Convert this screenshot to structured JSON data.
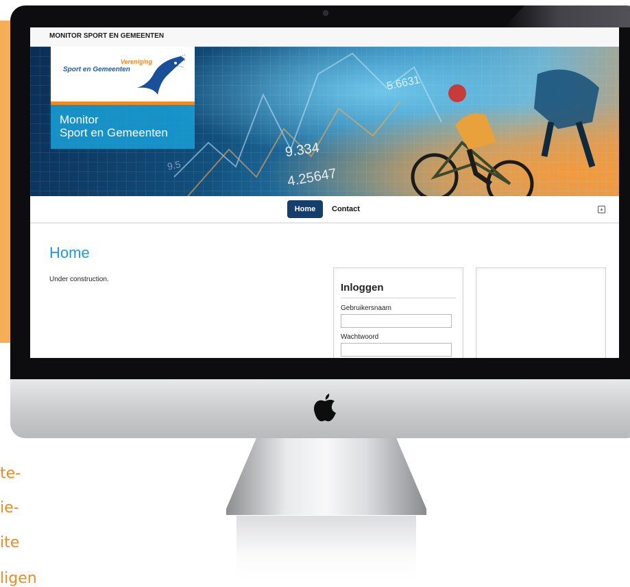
{
  "background_text": {
    "fragments": [
      "te-",
      "ie-",
      "ite",
      "ligen"
    ],
    "color": "#ee8c22"
  },
  "site": {
    "header_title": "MONITOR SPORT EN GEMEENTEN",
    "logo": {
      "line1": "Vereniging",
      "line2": "Sport en Gemeenten"
    },
    "banner_title": {
      "line1": "Monitor",
      "line2": "Sport en Gemeenten"
    },
    "banner_numbers": {
      "a": "9.334",
      "b": "4.25647",
      "c": "5.6631",
      "d": "9.5"
    },
    "nav": {
      "items": [
        {
          "label": "Home",
          "active": true
        },
        {
          "label": "Contact",
          "active": false
        }
      ],
      "toggle_icon": "collapse-icon"
    },
    "page": {
      "heading": "Home",
      "body": "Under construction."
    },
    "login": {
      "title": "Inloggen",
      "username_label": "Gebruikersnaam",
      "username_value": "",
      "password_label": "Wachtwoord",
      "password_value": ""
    }
  },
  "colors": {
    "accent_blue": "#1e9ad6",
    "nav_active": "#153e6d",
    "brand_orange": "#ee8c22"
  }
}
